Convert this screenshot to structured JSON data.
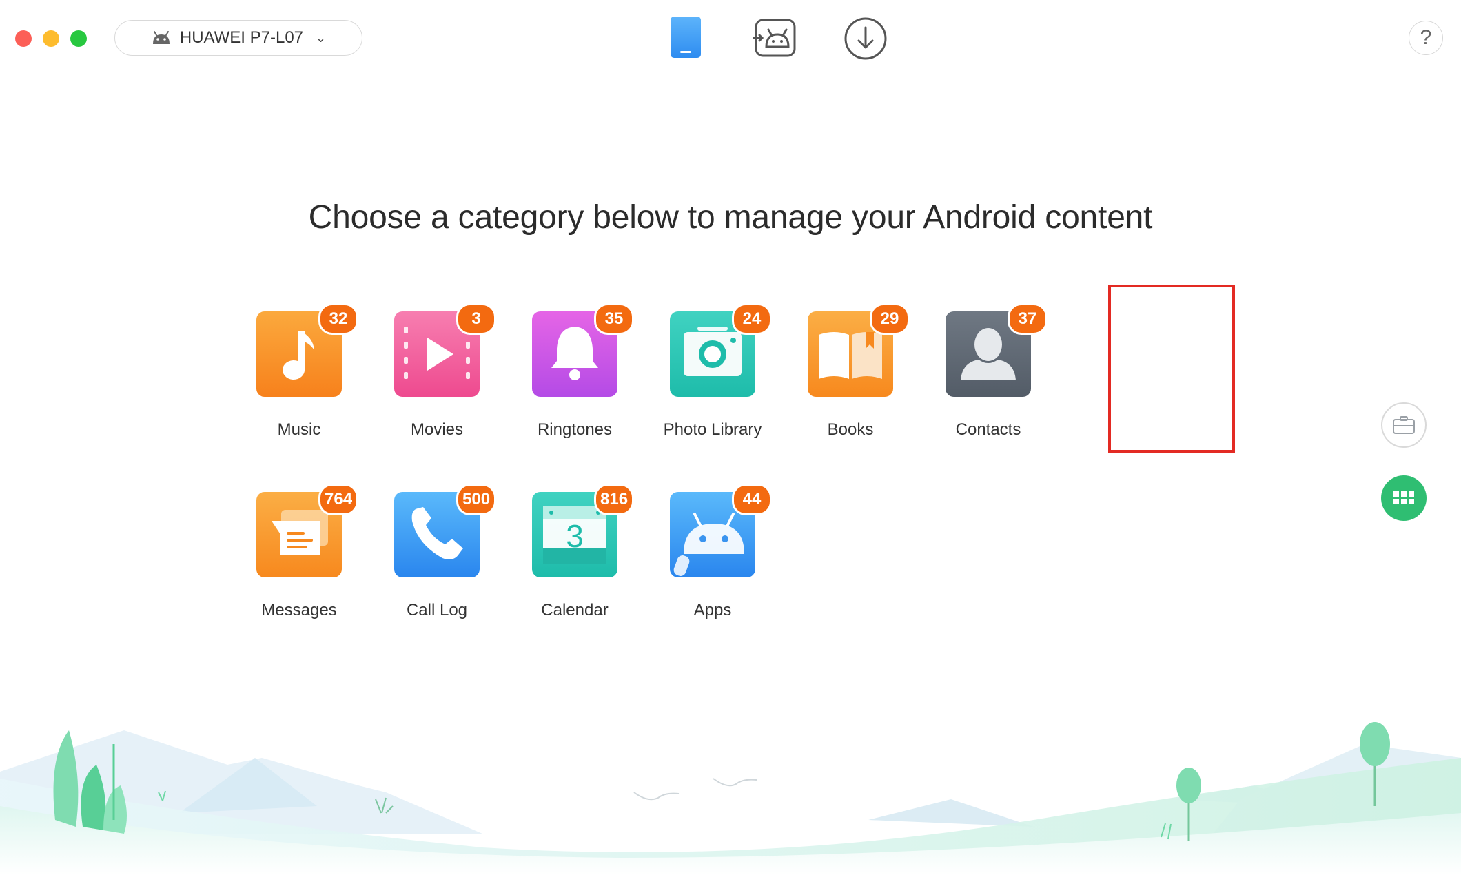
{
  "toolbar": {
    "device_name": "HUAWEI P7-L07",
    "nav_icons": [
      "phone-icon",
      "android-transfer-icon",
      "download-icon"
    ],
    "help_label": "?"
  },
  "main": {
    "headline": "Choose a category below to manage your Android content"
  },
  "categories": [
    {
      "label": "Music",
      "count": "32",
      "icon": "music-note-icon",
      "color_from": "#fba93d",
      "color_to": "#f7811c"
    },
    {
      "label": "Movies",
      "count": "3",
      "icon": "play-icon",
      "color_from": "#f77eb0",
      "color_to": "#ee4a8f"
    },
    {
      "label": "Ringtones",
      "count": "35",
      "icon": "bell-icon",
      "color_from": "#e565e6",
      "color_to": "#b44be6"
    },
    {
      "label": "Photo Library",
      "count": "24",
      "icon": "camera-icon",
      "color_from": "#40d2c1",
      "color_to": "#1ebcaa"
    },
    {
      "label": "Books",
      "count": "29",
      "icon": "book-icon",
      "color_from": "#fbae45",
      "color_to": "#f7891e"
    },
    {
      "label": "Contacts",
      "count": "37",
      "icon": "person-icon",
      "color_from": "#6f7883",
      "color_to": "#535c67",
      "selected": true
    },
    {
      "label": "Messages",
      "count": "764",
      "icon": "message-icon",
      "color_from": "#fbae45",
      "color_to": "#f7891e"
    },
    {
      "label": "Call Log",
      "count": "500",
      "icon": "phone-handset-icon",
      "color_from": "#5ab9fb",
      "color_to": "#2a86ee"
    },
    {
      "label": "Calendar",
      "count": "816",
      "icon": "calendar-icon",
      "color_from": "#40d2c1",
      "color_to": "#1ebcaa",
      "day": "3"
    },
    {
      "label": "Apps",
      "count": "44",
      "icon": "android-icon",
      "color_from": "#5ab9fb",
      "color_to": "#2a86ee"
    }
  ],
  "colors": {
    "badge": "#f36a10",
    "selection": "#e32a23",
    "accent_green": "#2fbe72"
  }
}
